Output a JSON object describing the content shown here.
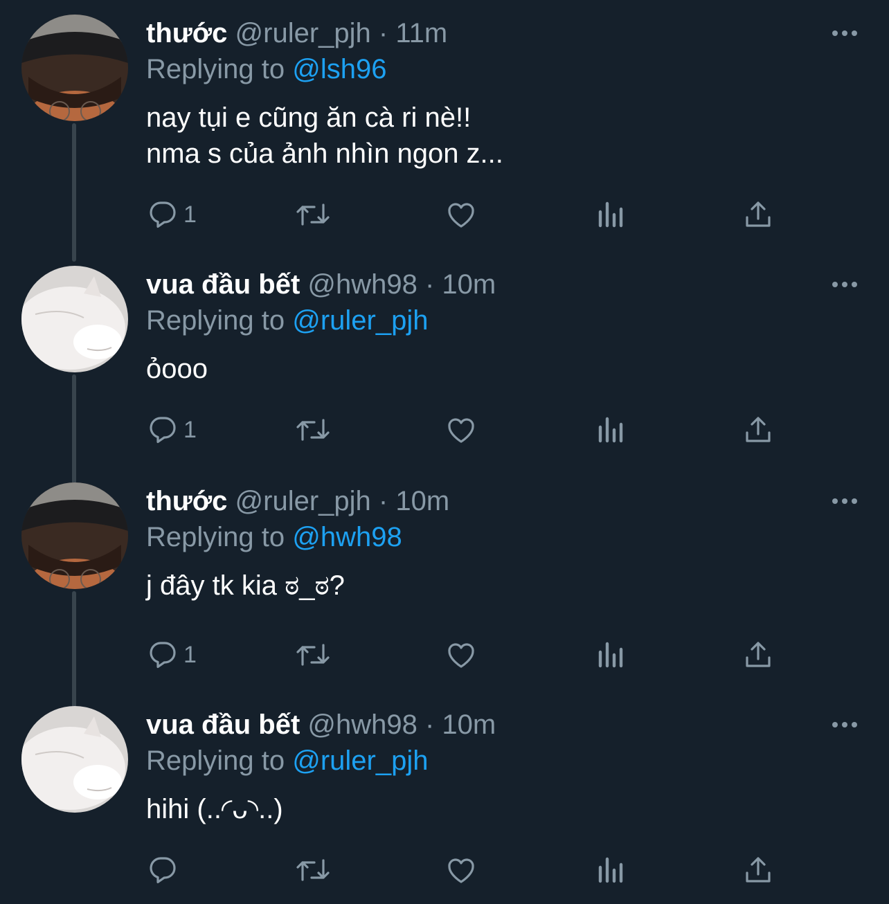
{
  "tweets": [
    {
      "display_name": "thước",
      "handle": "@ruler_pjh",
      "separator": " · ",
      "time": "11m",
      "replying_prefix": "Replying to ",
      "replying_to": "@lsh96",
      "text": "nay tụi e cũng ăn cà ri nè!!\nnma s của ảnh nhìn ngon z...",
      "reply_count": "1",
      "avatar": "person-with-cap-icon"
    },
    {
      "display_name": "vua đầu bết",
      "handle": "@hwh98",
      "separator": " · ",
      "time": "10m",
      "replying_prefix": "Replying to ",
      "replying_to": "@ruler_pjh",
      "text": "ỏooo",
      "reply_count": "1",
      "avatar": "white-cat-icon"
    },
    {
      "display_name": "thước",
      "handle": "@ruler_pjh",
      "separator": " · ",
      "time": "10m",
      "replying_prefix": "Replying to ",
      "replying_to": "@hwh98",
      "text": "j đây tk kia ಠ_ಠ?",
      "reply_count": "1",
      "avatar": "person-with-cap-icon"
    },
    {
      "display_name": "vua đầu bết",
      "handle": "@hwh98",
      "separator": " · ",
      "time": "10m",
      "replying_prefix": "Replying to ",
      "replying_to": "@ruler_pjh",
      "text": "hihi (..◜ᴗ◝..)",
      "reply_count": "",
      "avatar": "white-cat-icon"
    }
  ],
  "colors": {
    "background": "#15202b",
    "secondary_text": "#8899a6",
    "link": "#1da1f2",
    "thread_line": "#38444d"
  },
  "icons": [
    "reply-icon",
    "retweet-icon",
    "like-icon",
    "analytics-icon",
    "share-icon",
    "more-options-icon"
  ]
}
